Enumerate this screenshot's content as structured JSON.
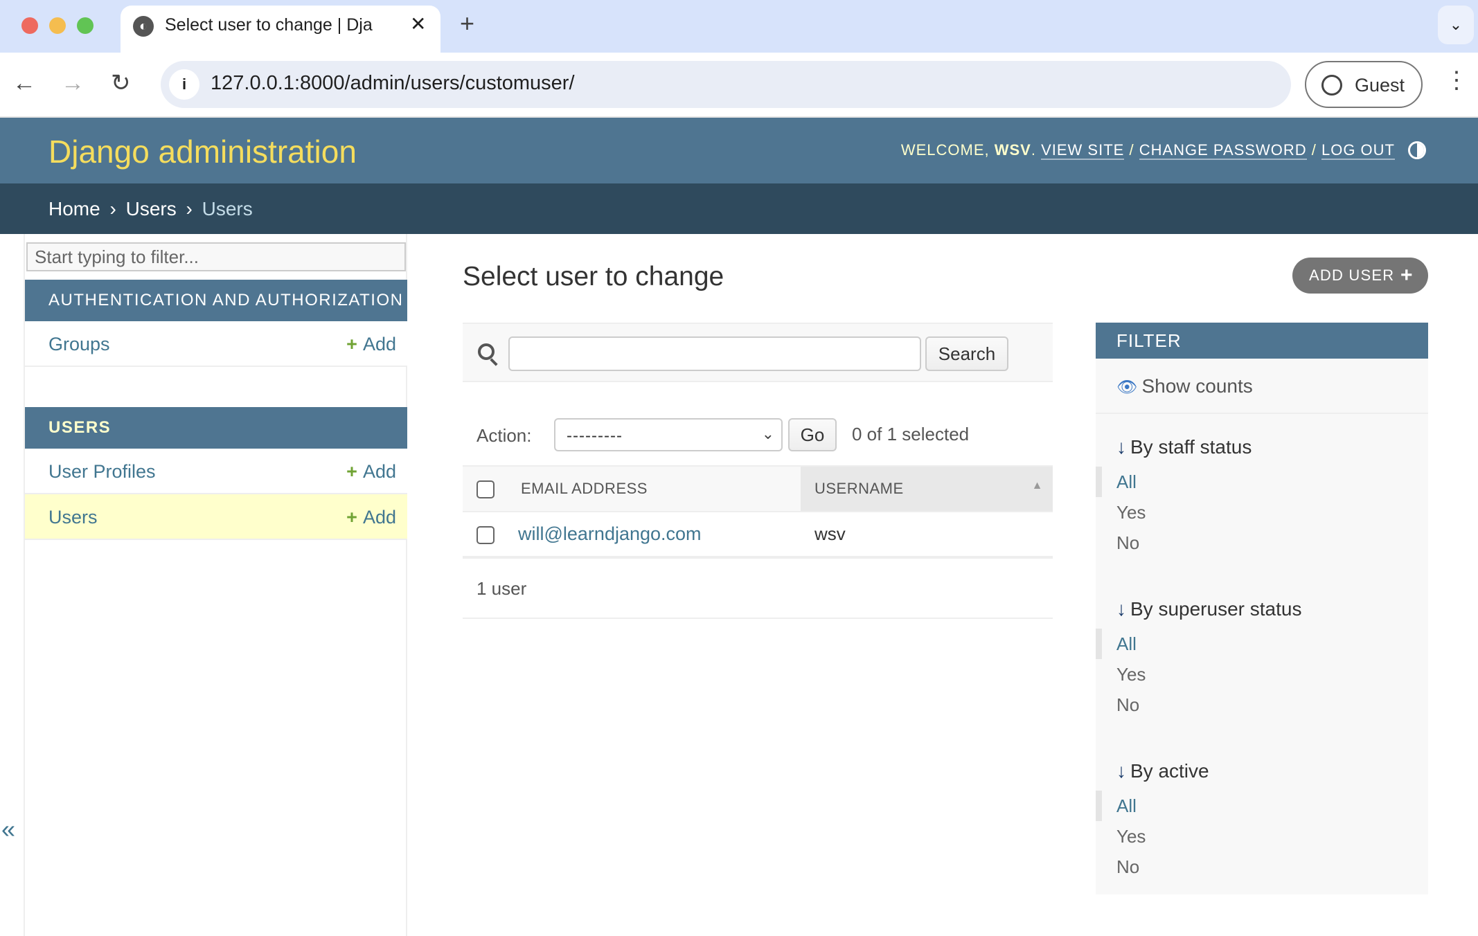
{
  "browser": {
    "tab_title": "Select user to change | Django site admin",
    "new_tab_icon": "plus-icon",
    "tab_close_glyph": "✕",
    "url": "127.0.0.1:8000/admin/users/customuser/",
    "profile_label": "Guest"
  },
  "header": {
    "branding": "Django administration",
    "welcome": "Welcome,",
    "username": "wsv",
    "view_site": "View site",
    "change_password": "Change password",
    "log_out": "Log out"
  },
  "breadcrumbs": {
    "home": "Home",
    "app": "Users",
    "current": "Users",
    "separator": "›"
  },
  "sidebar": {
    "filter_placeholder": "Start typing to filter...",
    "apps": [
      {
        "caption": "Authentication and Authorization",
        "models": [
          {
            "name": "Groups",
            "add_label": "Add"
          }
        ]
      },
      {
        "caption": "Users",
        "models": [
          {
            "name": "User Profiles",
            "add_label": "Add"
          },
          {
            "name": "Users",
            "add_label": "Add",
            "current": true
          }
        ]
      }
    ],
    "toggle_glyph": "«"
  },
  "content": {
    "title": "Select user to change",
    "add_button": "Add user",
    "search": {
      "value": "",
      "button_label": "Search"
    },
    "actions": {
      "label": "Action:",
      "selected_value": "---------",
      "go_label": "Go",
      "counter": "0 of 1 selected"
    },
    "table": {
      "columns": [
        "Email address",
        "Username"
      ],
      "sorted_column": "Username",
      "sort_direction": "ascending",
      "rows": [
        {
          "email": "will@learndjango.com",
          "username": "wsv"
        }
      ]
    },
    "paginator": "1 user"
  },
  "filter": {
    "title": "Filter",
    "show_counts": "Show counts",
    "groups": [
      {
        "heading": "By staff status",
        "options": [
          "All",
          "Yes",
          "No"
        ],
        "selected": "All"
      },
      {
        "heading": "By superuser status",
        "options": [
          "All",
          "Yes",
          "No"
        ],
        "selected": "All"
      },
      {
        "heading": "By active",
        "options": [
          "All",
          "Yes",
          "No"
        ],
        "selected": "All"
      }
    ]
  },
  "colors": {
    "header_bg": "#4f7591",
    "breadcrumbs_bg": "#2f4a5d",
    "branding": "#f5dd5d",
    "link": "#417690",
    "add_green": "#70a334",
    "current_row": "#ffffcc"
  }
}
